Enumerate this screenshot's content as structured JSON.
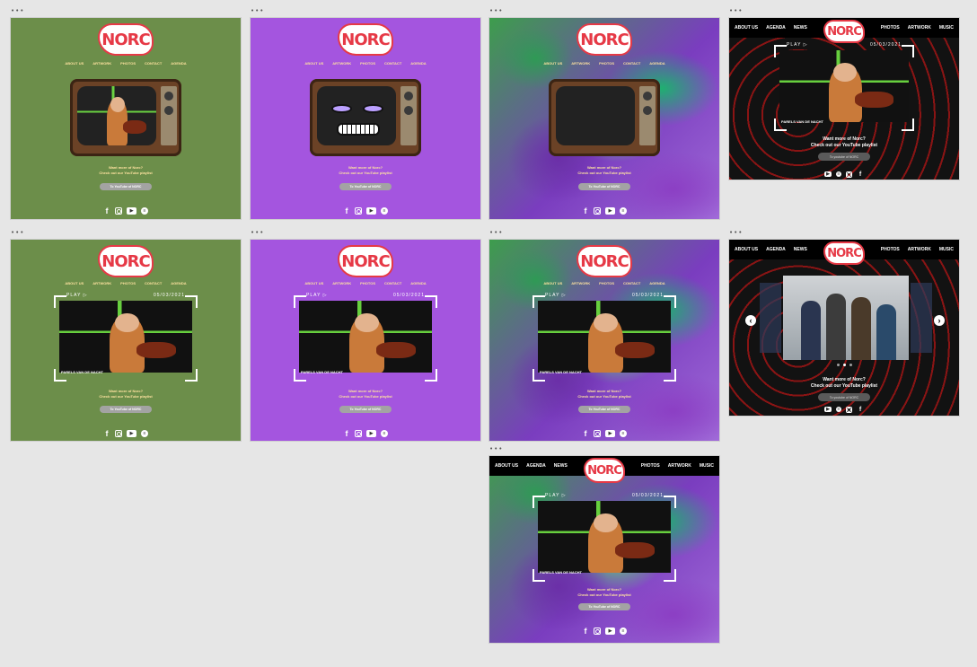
{
  "frame_label": "•••",
  "logo_text": "NORC",
  "nav": {
    "small": [
      "ABOUT US",
      "ARTWORK",
      "PHOTOS",
      "CONTACT",
      "AGENDA"
    ],
    "top_left": [
      "ABOUT US",
      "AGENDA",
      "NEWS"
    ],
    "top_right": [
      "PHOTOS",
      "ARTWORK",
      "MUSIC"
    ]
  },
  "cta": {
    "line1": "Want more of Norc?",
    "line2": "Check out our YouTube playlist",
    "button": "To YouTube of NORC",
    "dark_button": "To youtube of NORC"
  },
  "player": {
    "play_label": "PLAY ▷",
    "date": "05/03/2021",
    "video_title": "PARELS VAN DE NACHT"
  },
  "socials": [
    "facebook-icon",
    "instagram-icon",
    "youtube-icon",
    "spotify-icon"
  ],
  "colors": {
    "green": "#6c8e4a",
    "purple": "#a455df",
    "logo_red": "#e63946",
    "nav_text": "#ffe3a0"
  }
}
